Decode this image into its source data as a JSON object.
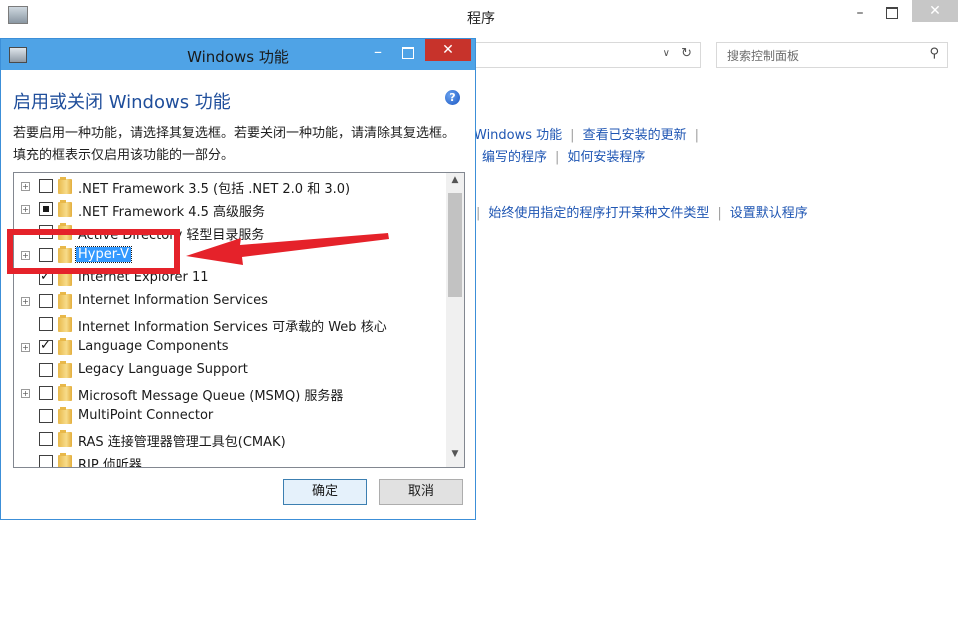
{
  "background_window": {
    "title": "程序",
    "minimize_label": "–",
    "close_label": "✕",
    "search": {
      "placeholder": "搜索控制面板"
    },
    "links_row1": [
      "Windows 功能",
      "查看已安装的更新"
    ],
    "links_row2": [
      "编写的程序",
      "如何安装程序"
    ],
    "links_row3": [
      "始终使用指定的程序打开某种文件类型",
      "设置默认程序"
    ]
  },
  "dialog": {
    "title": "Windows 功能",
    "minimize_label": "–",
    "close_label": "✕",
    "heading": "启用或关闭 Windows 功能",
    "description": "若要启用一种功能，请选择其复选框。若要关闭一种功能，请清除其复选框。填充的框表示仅启用该功能的一部分。",
    "features": [
      {
        "label": ".NET Framework 3.5 (包括 .NET 2.0 和 3.0)",
        "state": "unchecked",
        "expandable": true
      },
      {
        "label": ".NET Framework 4.5 高级服务",
        "state": "partial",
        "expandable": true
      },
      {
        "label": "Active Directory 轻型目录服务",
        "state": "unchecked",
        "expandable": false
      },
      {
        "label": "Hyper-V",
        "state": "unchecked",
        "expandable": true,
        "selected": true
      },
      {
        "label": "Internet Explorer 11",
        "state": "checked",
        "expandable": false
      },
      {
        "label": "Internet Information Services",
        "state": "unchecked",
        "expandable": true
      },
      {
        "label": "Internet Information Services 可承载的 Web 核心",
        "state": "unchecked",
        "expandable": false
      },
      {
        "label": "Language Components",
        "state": "checked",
        "expandable": true
      },
      {
        "label": "Legacy Language Support",
        "state": "unchecked",
        "expandable": false
      },
      {
        "label": "Microsoft Message Queue (MSMQ) 服务器",
        "state": "unchecked",
        "expandable": true
      },
      {
        "label": "MultiPoint Connector",
        "state": "unchecked",
        "expandable": false
      },
      {
        "label": "RAS 连接管理器管理工具包(CMAK)",
        "state": "unchecked",
        "expandable": false
      },
      {
        "label": "RIP 侦听器",
        "state": "unchecked",
        "expandable": false
      }
    ],
    "ok_label": "确定",
    "cancel_label": "取消"
  },
  "colors": {
    "dialog_titlebar": "#4fa3e6",
    "close_button": "#c7332b",
    "link": "#1f56b3",
    "selection": "#3399ff",
    "annotation": "#e5222a"
  }
}
